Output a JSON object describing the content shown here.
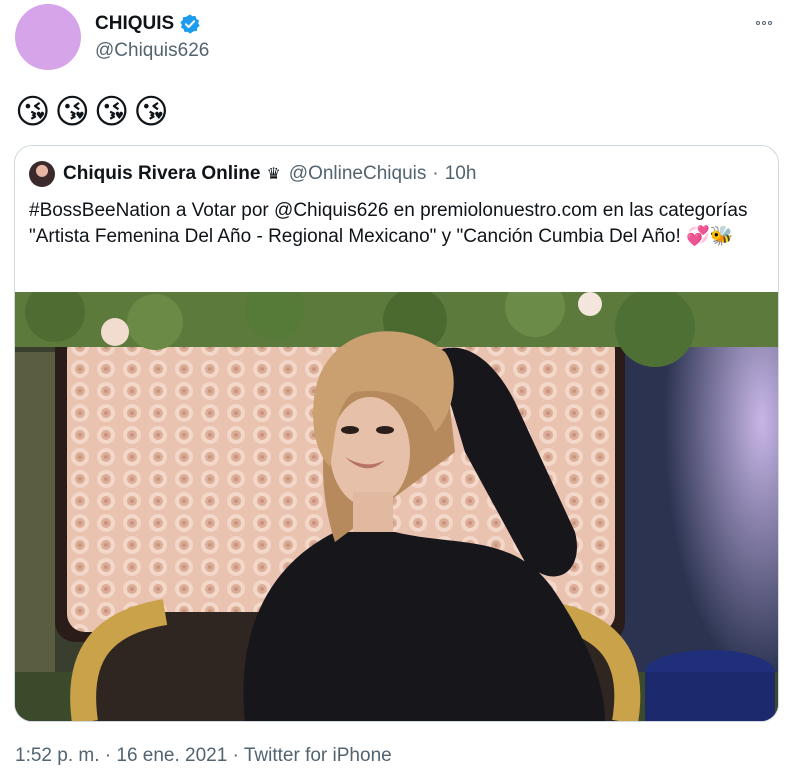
{
  "tweet": {
    "display_name": "CHIQUIS",
    "handle": "@Chiquis626",
    "text": "😘😘😘😘",
    "timestamp": "1:52 p. m. · 16 ene. 2021",
    "separator": " · ",
    "source": "Twitter for iPhone"
  },
  "quote": {
    "display_name": "Chiquis Rivera Online",
    "badge_emoji": "♛",
    "handle": "@OnlineChiquis",
    "dot": "·",
    "time": "10h",
    "text": "#BossBeeNation a Votar por @Chiquis626 en premiolonuestro.com en las categorías \"Artista Femenina Del Año - Regional Mexicano\" y \"Canción Cumbia Del Año! 💞🐝"
  },
  "colors": {
    "verified": "#1d9bf0",
    "secondary_text": "#536471",
    "border": "#cfd9de",
    "avatar_placeholder": "#d6a4e8"
  },
  "icons": [
    "verified-badge-icon",
    "more-options-icon",
    "crown-icon"
  ]
}
